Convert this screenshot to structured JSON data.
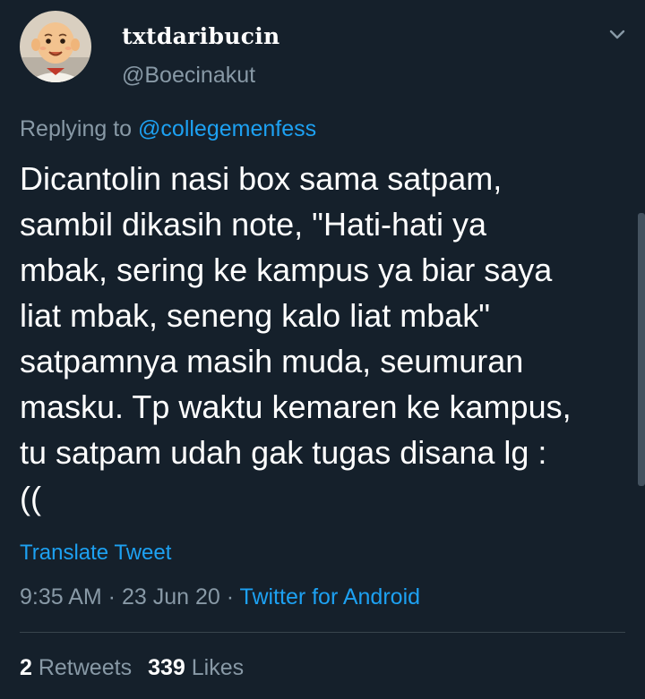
{
  "author": {
    "display_name": "txtdaribucin",
    "handle": "@Boecinakut",
    "avatar_icon": "cartoon-avatar-icon"
  },
  "reply": {
    "prefix": "Replying to ",
    "mention": "@collegemenfess"
  },
  "tweet": {
    "text": "Dicantolin nasi box sama satpam,\nsambil dikasih note, \"Hati-hati ya\nmbak, sering ke kampus ya biar saya\nliat mbak, seneng kalo liat mbak\"\nsatpamnya masih muda, seumuran\nmasku. Tp waktu kemaren ke kampus,\ntu satpam udah gak tugas disana lg :\n(("
  },
  "translate_label": "Translate Tweet",
  "meta": {
    "time": "9:35 AM",
    "separator": " · ",
    "date": "23 Jun 20",
    "separator2": " · ",
    "source": "Twitter for Android"
  },
  "stats": {
    "retweets_count": "2",
    "retweets_label": " Retweets",
    "likes_count": "339",
    "likes_label": " Likes"
  },
  "colors": {
    "background": "#15202b",
    "text": "#ffffff",
    "secondary": "#8899a6",
    "accent": "#1da1f2",
    "divider": "#38444d"
  }
}
